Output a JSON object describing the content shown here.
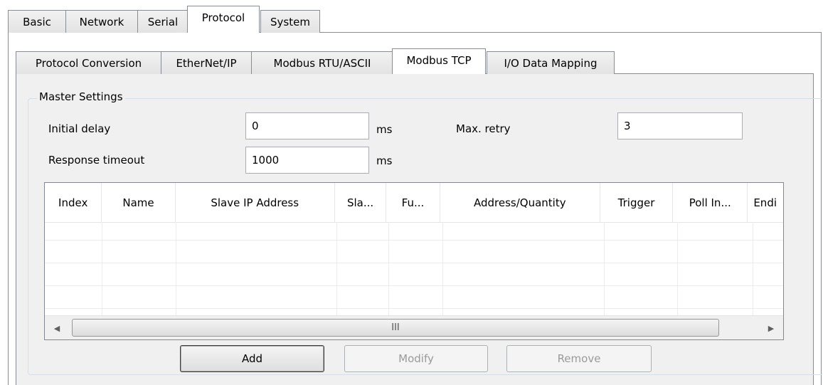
{
  "main_tabs": [
    "Basic",
    "Network",
    "Serial",
    "Protocol",
    "System"
  ],
  "main_active": "Protocol",
  "sub_tabs": [
    "Protocol Conversion",
    "EtherNet/IP",
    "Modbus RTU/ASCII",
    "Modbus TCP",
    "I/O Data Mapping"
  ],
  "sub_active": "Modbus TCP",
  "master": {
    "group_label": "Master Settings",
    "initial_delay_label": "Initial delay",
    "initial_delay_value": "0",
    "initial_delay_unit": "ms",
    "max_retry_label": "Max. retry",
    "max_retry_value": "3",
    "response_timeout_label": "Response timeout",
    "response_timeout_value": "1000",
    "response_timeout_unit": "ms"
  },
  "table": {
    "columns": [
      "Index",
      "Name",
      "Slave IP Address",
      "Sla...",
      "Fu...",
      "Address/Quantity",
      "Trigger",
      "Poll In...",
      "Endi"
    ],
    "rows": [],
    "scroll_grip": "III"
  },
  "buttons": {
    "add": "Add",
    "modify": "Modify",
    "remove": "Remove"
  }
}
